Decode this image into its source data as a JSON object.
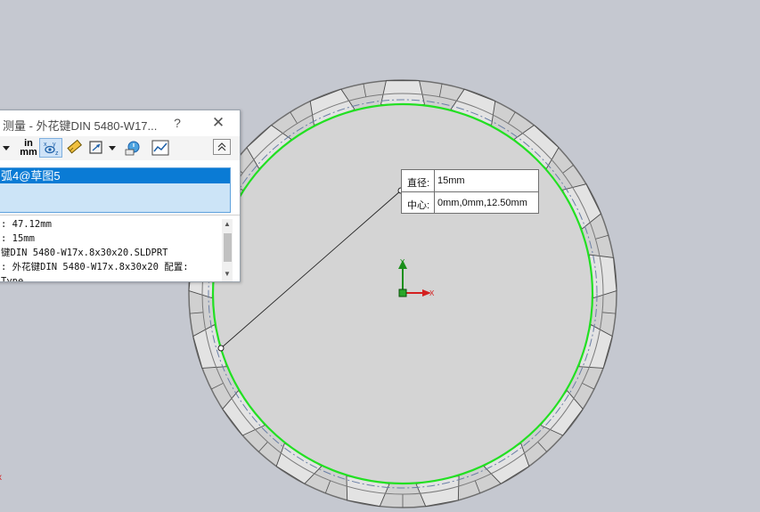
{
  "dialog": {
    "title": "测量 - 外花键DIN 5480-W17...",
    "help_glyph": "?",
    "close_glyph": "✕",
    "toolbar": {
      "units_top": "in",
      "units_bottom": "mm",
      "collapse_glyph": "⌃"
    },
    "selection": {
      "item": "弧4@草图5"
    },
    "results": [
      ": 47.12mm",
      ": 15mm",
      "键DIN 5480-W17x.8x30x20.SLDPRT",
      ":  外花键DIN 5480-W17x.8x30x20 配置:",
      "Type"
    ]
  },
  "tooltip": {
    "diameter_label": "直径:",
    "diameter_value": "15mm",
    "center_label": "中心:",
    "center_value": "0mm,0mm,12.50mm"
  },
  "triad": {
    "x_label": "X",
    "y_label": "Y"
  },
  "colors": {
    "viewport_bg": "#c5c8d0",
    "part_face": "#d3d3d3",
    "selected_edge": "#00e600",
    "selection_highlight": "#0a7bd5",
    "axis_x": "#e02020",
    "axis_y": "#209020"
  }
}
